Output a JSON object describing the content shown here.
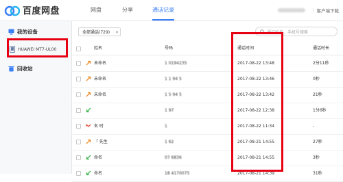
{
  "app": {
    "title": "百度网盘",
    "nav": [
      {
        "label": "网盘"
      },
      {
        "label": "分享"
      },
      {
        "label": "通话记录"
      }
    ],
    "client_download": "客户端下载"
  },
  "sidebar": {
    "my_devices": "我的设备",
    "device_name": "HUAWEI MT7-UL00",
    "recycle": "回收站"
  },
  "toolbar": {
    "filter_label": "全部通话(729)",
    "search_placeholder": "通过姓名、手机号搜索"
  },
  "table": {
    "columns": [
      "姓名",
      "号码",
      "通话时间",
      "通话时长"
    ],
    "rows": [
      {
        "name": "未命名",
        "number": "1 0194235",
        "time": "2017-08-22 13:48",
        "duration": "2分11秒",
        "type": "outgoing"
      },
      {
        "name": "未命名",
        "number": "1 1 94 5",
        "time": "2017-08-22 13:46",
        "duration": "0秒",
        "type": "outgoing"
      },
      {
        "name": "未命名",
        "number": "1 5 94 5",
        "time": "2017-08-22 13:42",
        "duration": "21秒",
        "type": "outgoing"
      },
      {
        "name": "",
        "number": "1 97",
        "time": "2017-08-22 12:38",
        "duration": "1分6秒",
        "type": "incoming"
      },
      {
        "name": "玄 时",
        "number": "1",
        "time": "2017-08-22 11:34",
        "duration": "-",
        "type": "missed"
      },
      {
        "name": "「 先生",
        "number": "1 62",
        "time": "2017-08-21 14:55",
        "duration": "27秒",
        "type": "outgoing"
      },
      {
        "name": "命名",
        "number": "07 6836",
        "time": "2017-08-21 14:55",
        "duration": "3秒",
        "type": "incoming"
      },
      {
        "name": "命名",
        "number": "18 4170075",
        "time": "2017-08-21 14:39",
        "duration": "31秒",
        "type": "incoming"
      }
    ]
  },
  "colors": {
    "accent": "#3a7ff6",
    "highlight": "#e60012",
    "outgoing": "#f08a24",
    "incoming": "#3bb54a",
    "missed": "#e64a3b"
  },
  "icons": {
    "logo": "cloud-logo-icon",
    "devices": "monitor-icon",
    "phone": "phone-icon",
    "recycle": "trash-icon",
    "search": "search-icon"
  }
}
